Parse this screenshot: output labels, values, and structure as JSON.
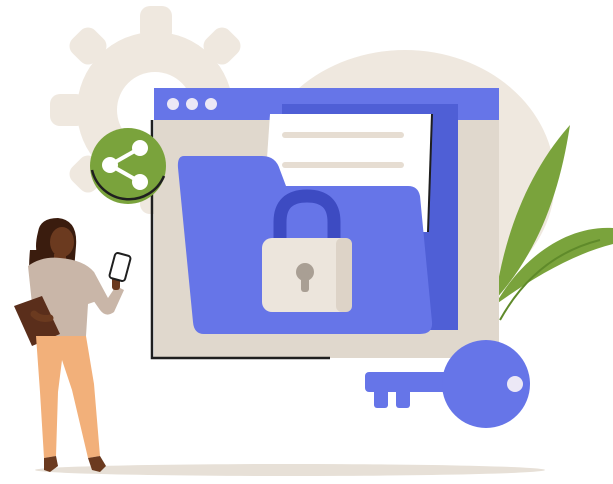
{
  "illustration": {
    "colors": {
      "backdrop": "#efe8df",
      "window_frame": "#e0d8cd",
      "window_titlebar": "#6675e8",
      "folder": "#6675e8",
      "folder_back": "#4f5fd6",
      "document": "#ffffff",
      "document_lines": "#e6ddd2",
      "padlock_body": "#ece5dc",
      "padlock_shackle": "#3d4bc2",
      "share_badge": "#7aa33c",
      "leaf": "#7aa33c",
      "key": "#6675e8",
      "person_skin": "#6b3a1f",
      "person_hair": "#3a1c0e",
      "person_shirt": "#c9b6a8",
      "person_pants": "#f2b07a",
      "person_folder": "#5a2e1b",
      "ground_shadow": "#e7e0d7"
    },
    "icons": [
      "gear-icon",
      "share-icon",
      "padlock-icon",
      "key-icon",
      "leaf-icon",
      "folder-icon",
      "document-icon",
      "phone-icon"
    ]
  }
}
